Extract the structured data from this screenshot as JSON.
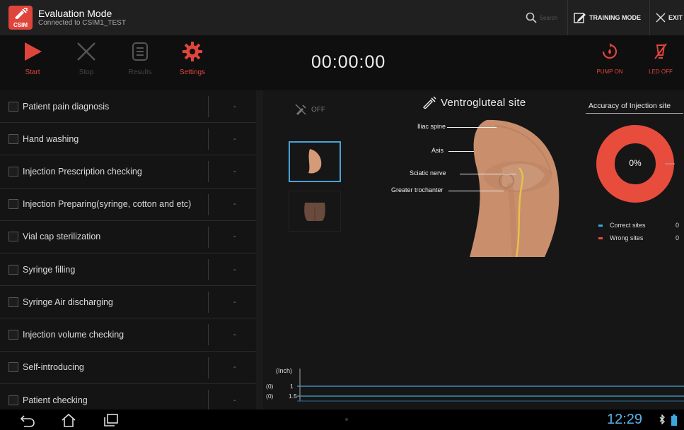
{
  "titlebar": {
    "app_logo_text": "CSIM",
    "title": "Evaluation Mode",
    "subtitle": "Connected to CSIM1_TEST",
    "search_placeholder": "Search",
    "training_mode": "TRAINING MODE",
    "exit": "EXIT"
  },
  "toolbar": {
    "start": "Start",
    "stop": "Stop",
    "results": "Results",
    "settings": "Settings",
    "timer": "00:00:00",
    "pump": "PUMP ON",
    "led": "LED OFF"
  },
  "checklist": [
    {
      "label": "Patient pain diagnosis",
      "value": "-"
    },
    {
      "label": "Hand washing",
      "value": "-"
    },
    {
      "label": "Injection Prescription checking",
      "value": "-"
    },
    {
      "label": "Injection Preparing(syringe, cotton and etc)",
      "value": "-"
    },
    {
      "label": "Vial cap sterilization",
      "value": "-"
    },
    {
      "label": "Syringe filling",
      "value": "-"
    },
    {
      "label": "Syringe Air discharging",
      "value": "-"
    },
    {
      "label": "Injection volume checking",
      "value": "-"
    },
    {
      "label": "Self-introducing",
      "value": "-"
    },
    {
      "label": "Patient checking",
      "value": "-"
    }
  ],
  "main": {
    "sound_state": "OFF",
    "site_title": "Ventrogluteal site",
    "anatomy": {
      "iliac_spine": "Iliac spine",
      "asis": "Asis",
      "sciatic_nerve": "Sciatic nerve",
      "greater_trochanter": "Greater trochanter"
    },
    "accuracy": {
      "title": "Accuracy of Injection site",
      "percent_label": "0%",
      "correct_label": "Correct sites",
      "correct_count": "0",
      "wrong_label": "Wrong sites",
      "wrong_count": "0"
    },
    "graph": {
      "unit": "(Inch)",
      "row1_idx": "(0)",
      "row1_val": "1",
      "row2_idx": "(0)",
      "row2_val": "1.5"
    }
  },
  "navbar": {
    "clock": "12:29"
  },
  "colors": {
    "accent_red": "#e0453c",
    "accent_blue": "#4aa3d8",
    "correct_color": "#3aa7e0",
    "wrong_color": "#e84c3d"
  }
}
